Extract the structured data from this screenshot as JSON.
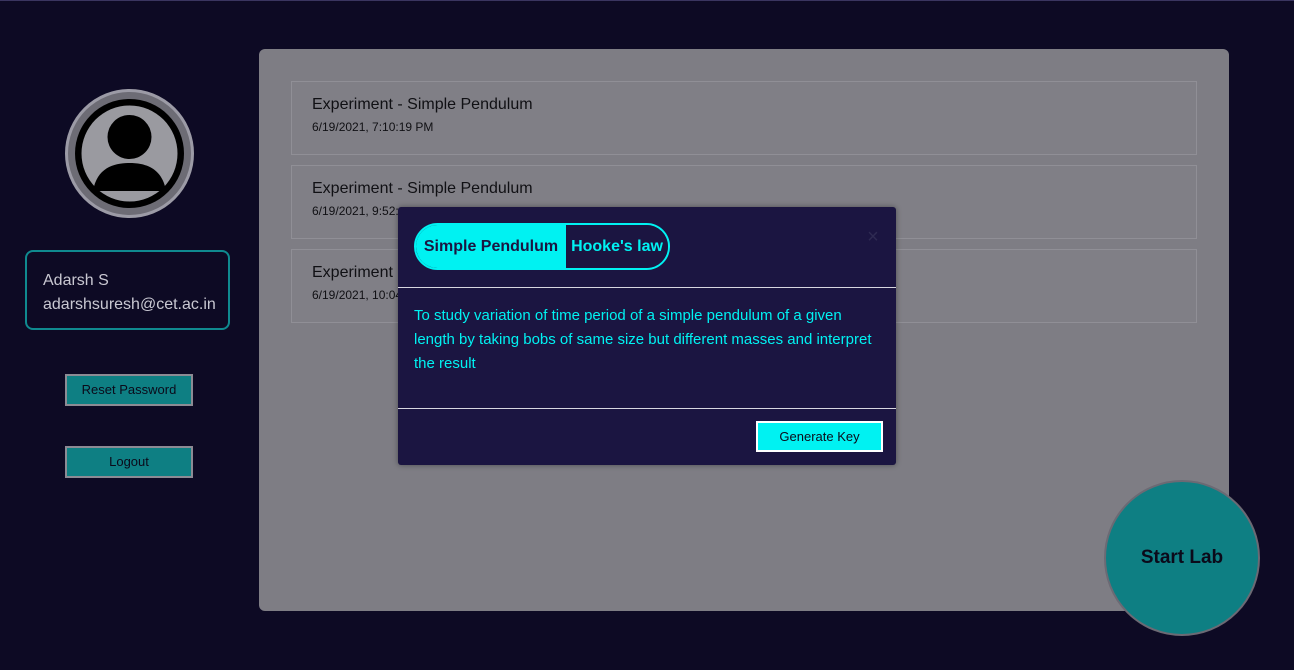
{
  "user": {
    "name": "Adarsh S",
    "email": "adarshsuresh@cet.ac.in"
  },
  "sidebar": {
    "reset_password_label": "Reset Password",
    "logout_label": "Logout"
  },
  "experiments": [
    {
      "title": "Experiment - Simple Pendulum",
      "timestamp": "6/19/2021, 7:10:19 PM"
    },
    {
      "title": "Experiment - Simple Pendulum",
      "timestamp": "6/19/2021, 9:52:"
    },
    {
      "title": "Experiment",
      "timestamp": "6/19/2021, 10:04"
    }
  ],
  "modal": {
    "tabs": [
      {
        "label": "Simple Pendulum",
        "active": true
      },
      {
        "label": "Hooke's law",
        "active": false
      }
    ],
    "close_symbol": "×",
    "description": "To study variation of time period of a simple pendulum of a given length by taking bobs of same size but different masses and interpret the result",
    "generate_key_label": "Generate Key"
  },
  "start_lab_label": "Start Lab",
  "colors": {
    "background": "#0d0a24",
    "accent_teal": "#0e7f83",
    "accent_cyan": "#00f2f2",
    "modal_bg": "#1b1541"
  }
}
